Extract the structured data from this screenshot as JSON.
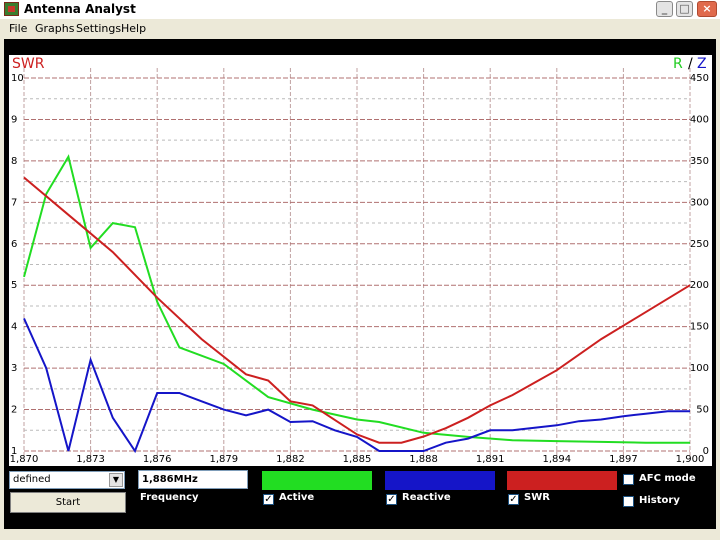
{
  "window": {
    "title": "Antenna Analyst",
    "min": "_",
    "max": "□",
    "close": "×"
  },
  "menu": [
    {
      "label": "File"
    },
    {
      "label": "Graphs"
    },
    {
      "label": "Settings"
    },
    {
      "label": "Help"
    }
  ],
  "colors": {
    "active": "#22dd22",
    "reactive": "#1515c8",
    "swr": "#cc2020",
    "grid": "#9a9a9a",
    "background": "#ffffff",
    "r_label": "#22cc22",
    "z_label": "#1515c8"
  },
  "chart_data": {
    "type": "line",
    "left_axis_label": "SWR",
    "right_axis_label_r": "R",
    "right_axis_separator": "/",
    "right_axis_label_z": "Z",
    "x_ticks": [
      "1,870",
      "1,873",
      "1,876",
      "1,879",
      "1,882",
      "1,885",
      "1,888",
      "1,891",
      "1,894",
      "1,897",
      "1,900"
    ],
    "y_left_ticks": [
      "1",
      "2",
      "3",
      "4",
      "5",
      "6",
      "7",
      "8",
      "9",
      "10"
    ],
    "y_right_ticks": [
      "0",
      "50",
      "100",
      "150",
      "200",
      "250",
      "300",
      "350",
      "400",
      "450"
    ],
    "xlim": [
      1.87,
      1.9
    ],
    "ylim_left": [
      1,
      10
    ],
    "ylim_right": [
      0,
      450
    ],
    "series": [
      {
        "key": "active",
        "x": [
          1.87,
          1.871,
          1.872,
          1.873,
          1.874,
          1.875,
          1.876,
          1.877,
          1.879,
          1.881,
          1.883,
          1.885,
          1.886,
          1.888,
          1.89,
          1.892,
          1.894,
          1.896,
          1.898,
          1.9
        ],
        "y": [
          210,
          310,
          355,
          245,
          275,
          270,
          180,
          125,
          105,
          65,
          50,
          38,
          35,
          22,
          17,
          13,
          12,
          11,
          10,
          10
        ]
      },
      {
        "key": "reactive",
        "x": [
          1.87,
          1.871,
          1.872,
          1.873,
          1.874,
          1.875,
          1.876,
          1.877,
          1.878,
          1.879,
          1.88,
          1.881,
          1.882,
          1.883,
          1.884,
          1.885,
          1.886,
          1.887,
          1.888,
          1.889,
          1.89,
          1.891,
          1.892,
          1.893,
          1.894,
          1.895,
          1.896,
          1.897,
          1.898,
          1.899,
          1.9
        ],
        "y": [
          160,
          100,
          0,
          110,
          40,
          -5,
          70,
          70,
          60,
          50,
          43,
          50,
          35,
          36,
          25,
          17,
          0,
          0,
          0,
          10,
          15,
          25,
          25,
          28,
          31,
          36,
          38,
          42,
          45,
          48,
          48
        ]
      },
      {
        "key": "swr",
        "x": [
          1.87,
          1.872,
          1.874,
          1.876,
          1.878,
          1.88,
          1.881,
          1.882,
          1.883,
          1.884,
          1.885,
          1.886,
          1.887,
          1.888,
          1.889,
          1.89,
          1.891,
          1.892,
          1.894,
          1.896,
          1.898,
          1.9
        ],
        "y": [
          7.6,
          6.7,
          5.8,
          4.7,
          3.7,
          2.85,
          2.7,
          2.2,
          2.1,
          1.75,
          1.4,
          1.2,
          1.2,
          1.35,
          1.55,
          1.8,
          2.1,
          2.35,
          2.95,
          3.7,
          4.35,
          5.0
        ]
      }
    ]
  },
  "controls": {
    "mode_select": {
      "value": "defined",
      "arrow": "▼"
    },
    "start_button": "Start",
    "frequency_value": "1,886MHz",
    "frequency_label": "Frequency",
    "active": {
      "label": "Active",
      "checked": "✓"
    },
    "reactive": {
      "label": "Reactive",
      "checked": "✓"
    },
    "swr": {
      "label": "SWR",
      "checked": "✓"
    },
    "afc": {
      "label": "AFC mode",
      "checked": ""
    },
    "history": {
      "label": "History",
      "checked": ""
    }
  }
}
